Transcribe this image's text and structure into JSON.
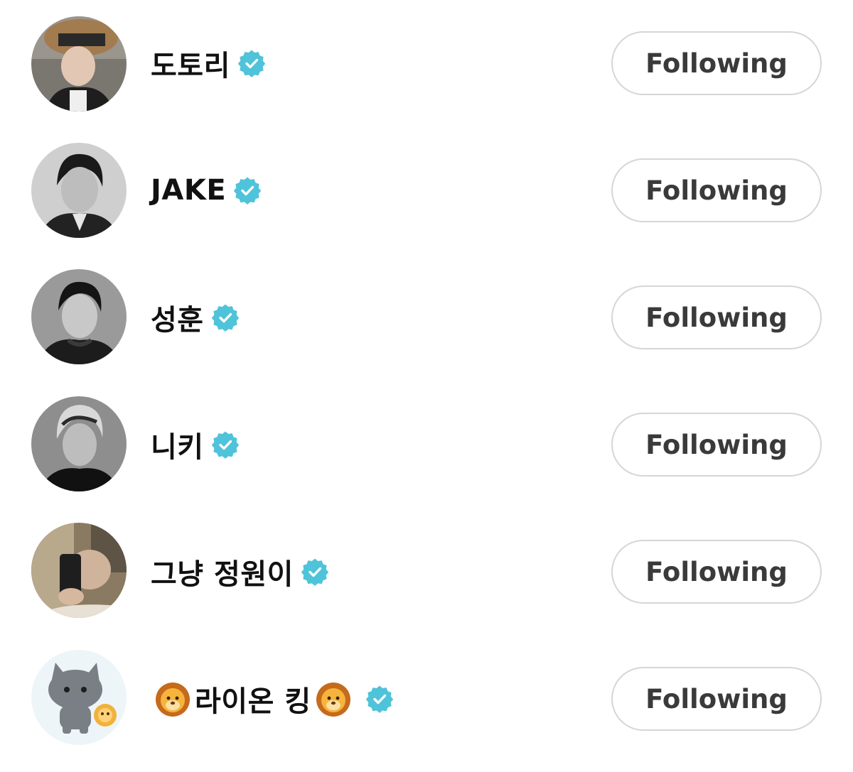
{
  "accent": "#4fc3d9",
  "users": [
    {
      "name": "도토리",
      "avatar": "avatar-cap-fur",
      "button_label": "Following"
    },
    {
      "name": "JAKE",
      "avatar": "avatar-bw-portrait",
      "button_label": "Following"
    },
    {
      "name": "성훈",
      "avatar": "avatar-bw-portrait",
      "button_label": "Following"
    },
    {
      "name": "니키",
      "avatar": "avatar-bw-portrait",
      "button_label": "Following"
    },
    {
      "name": "그냥 정원이",
      "avatar": "avatar-mirror-selfie",
      "button_label": "Following"
    },
    {
      "name": "라이온 킹",
      "avatar": "avatar-cartoon-cat",
      "button_label": "Following",
      "decorations": [
        "lion-emoji",
        "lion-emoji"
      ]
    }
  ]
}
